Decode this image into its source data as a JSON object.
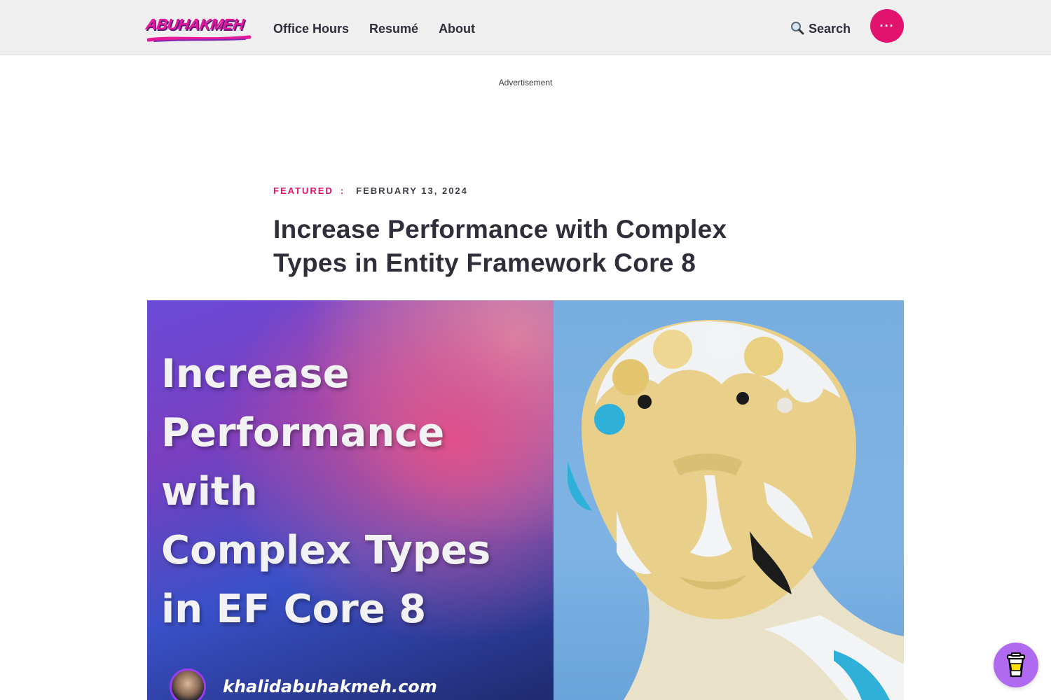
{
  "header": {
    "logo_text": "ABUHAKMEH",
    "nav": [
      "Office Hours",
      "Resumé",
      "About"
    ],
    "search_label": "Search",
    "menu_label": "···"
  },
  "ad": {
    "label": "Advertisement"
  },
  "article": {
    "category": "FEATURED",
    "separator": ":",
    "date": "FEBRUARY 13, 2024",
    "title": "Increase Performance with Complex Types in Entity Framework Core 8"
  },
  "hero": {
    "lines": [
      "Increase",
      "Performance",
      "with",
      "Complex Types",
      "in EF Core 8"
    ],
    "site": "khalidabuhakmeh.com"
  },
  "colors": {
    "accent": "#e2136e",
    "coffee": "#b06af0"
  }
}
